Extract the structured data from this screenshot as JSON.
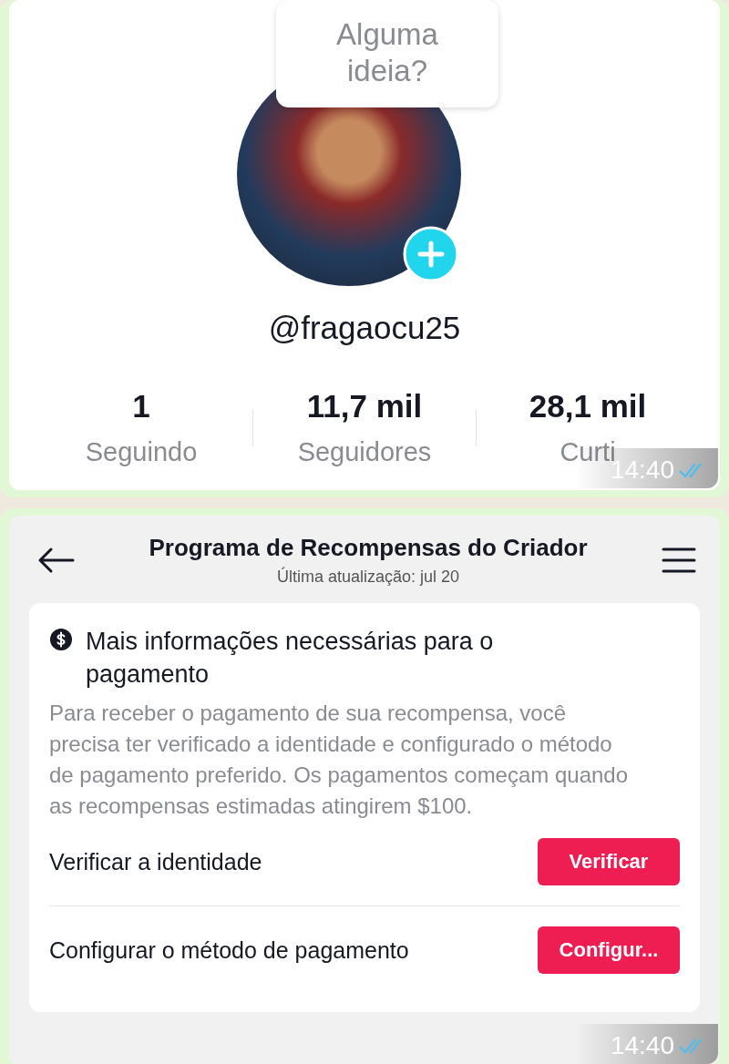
{
  "messages": [
    {
      "kind": "profile",
      "tooltip": "Alguma ideia?",
      "username": "@fragaocu25",
      "stats": [
        {
          "value": "1",
          "label": "Seguindo"
        },
        {
          "value": "11,7 mil",
          "label": "Seguidores"
        },
        {
          "value": "28,1 mil",
          "label": "Curti"
        }
      ],
      "time": "14:40",
      "read": true
    },
    {
      "kind": "rewards",
      "title": "Programa de Recompensas do Criador",
      "updated": "Última atualização: jul 20",
      "notice": {
        "title": "Mais informações necessárias para o pagamento",
        "body": "Para receber o pagamento de sua recompensa, você precisa ter verificado a identidade e configurado o método de pagamento preferido. Os pagamentos começam quando as recompensas estimadas atingirem $100."
      },
      "actions": [
        {
          "label": "Verificar a identidade",
          "button": "Verificar"
        },
        {
          "label": "Configurar o método de pagamento",
          "button": "Configur..."
        }
      ],
      "time": "14:40",
      "read": true
    }
  ]
}
